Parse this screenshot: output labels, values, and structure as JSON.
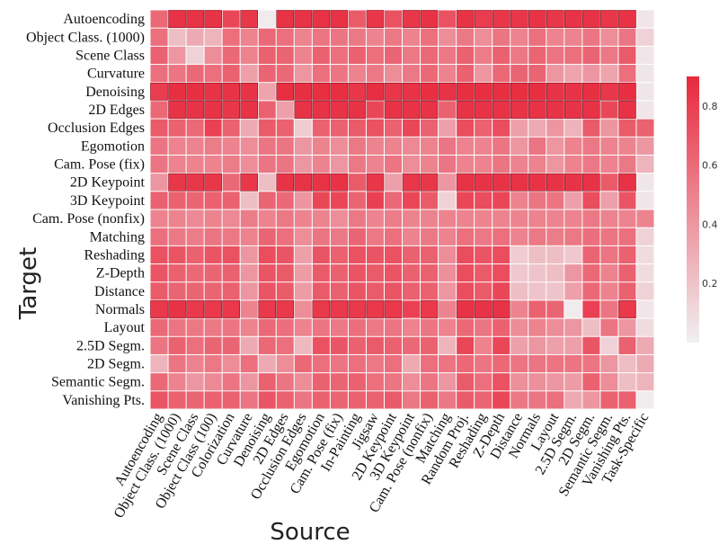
{
  "chart_data": {
    "type": "heatmap",
    "title": "",
    "xlabel": "Source",
    "ylabel": "Target",
    "x_categories": [
      "Autoencoding",
      "Object Class. (1000)",
      "Scene Class",
      "Object Class (100)",
      "Colorization",
      "Curvature",
      "Denoising",
      "2D Edges",
      "Occlusion Edges",
      "Egomotion",
      "Cam. Pose (fix)",
      "In-Painting",
      "Jigsaw",
      "2D Keypoint",
      "3D Keypoint",
      "Cam. Pose (nonfix)",
      "Matching",
      "Random Proj.",
      "Reshading",
      "Z-Depth",
      "Distance",
      "Normals",
      "Layout",
      "2.5D Segm.",
      "2D Segm.",
      "Semantic Segm.",
      "Vanishing Pts.",
      "Task-Specific"
    ],
    "y_categories": [
      "Autoencoding",
      "Object Class. (1000)",
      "Scene Class",
      "Curvature",
      "Denoising",
      "2D Edges",
      "Occlusion Edges",
      "Egomotion",
      "Cam. Pose (fix)",
      "2D Keypoint",
      "3D Keypoint",
      "Cam. Pose (nonfix)",
      "Matching",
      "Reshading",
      "Z-Depth",
      "Distance",
      "Normals",
      "Layout",
      "2.5D Segm.",
      "2D Segm.",
      "Semantic Segm.",
      "Vanishing Pts."
    ],
    "values": [
      [
        0.68,
        0.95,
        0.95,
        0.95,
        0.85,
        0.93,
        0.02,
        0.95,
        0.95,
        0.95,
        0.95,
        0.75,
        0.93,
        0.8,
        0.93,
        0.95,
        0.8,
        0.95,
        0.9,
        0.93,
        0.93,
        0.95,
        0.93,
        0.95,
        0.95,
        0.93,
        0.95,
        0.05
      ],
      [
        0.65,
        0.25,
        0.35,
        0.3,
        0.65,
        0.55,
        0.68,
        0.65,
        0.55,
        0.62,
        0.62,
        0.6,
        0.55,
        0.6,
        0.55,
        0.65,
        0.5,
        0.6,
        0.5,
        0.62,
        0.55,
        0.65,
        0.55,
        0.55,
        0.62,
        0.5,
        0.62,
        0.15
      ],
      [
        0.72,
        0.45,
        0.15,
        0.5,
        0.68,
        0.55,
        0.72,
        0.7,
        0.55,
        0.72,
        0.65,
        0.72,
        0.65,
        0.7,
        0.6,
        0.68,
        0.6,
        0.72,
        0.58,
        0.72,
        0.6,
        0.7,
        0.62,
        0.65,
        0.7,
        0.6,
        0.75,
        0.05
      ],
      [
        0.65,
        0.62,
        0.68,
        0.65,
        0.72,
        0.4,
        0.7,
        0.68,
        0.45,
        0.65,
        0.62,
        0.55,
        0.6,
        0.5,
        0.6,
        0.68,
        0.55,
        0.72,
        0.45,
        0.68,
        0.7,
        0.7,
        0.45,
        0.38,
        0.45,
        0.38,
        0.65,
        0.05
      ],
      [
        0.9,
        0.97,
        0.97,
        0.95,
        0.95,
        0.95,
        0.38,
        0.97,
        0.97,
        0.97,
        0.97,
        0.93,
        0.97,
        0.93,
        0.95,
        0.97,
        0.95,
        0.97,
        0.97,
        0.97,
        0.97,
        0.97,
        0.95,
        0.95,
        0.97,
        0.93,
        0.97,
        0.05
      ],
      [
        0.68,
        0.95,
        0.95,
        0.95,
        0.93,
        0.95,
        0.72,
        0.4,
        0.95,
        0.95,
        0.95,
        0.95,
        0.85,
        0.95,
        0.95,
        0.95,
        0.72,
        0.95,
        0.95,
        0.95,
        0.95,
        0.95,
        0.95,
        0.95,
        0.95,
        0.85,
        0.95,
        0.05
      ],
      [
        0.75,
        0.72,
        0.68,
        0.88,
        0.72,
        0.35,
        0.75,
        0.72,
        0.18,
        0.72,
        0.72,
        0.75,
        0.8,
        0.72,
        0.85,
        0.72,
        0.4,
        0.82,
        0.72,
        0.82,
        0.4,
        0.35,
        0.45,
        0.3,
        0.75,
        0.45,
        0.75,
        0.72
      ],
      [
        0.62,
        0.55,
        0.55,
        0.58,
        0.55,
        0.5,
        0.62,
        0.62,
        0.45,
        0.55,
        0.5,
        0.6,
        0.55,
        0.55,
        0.52,
        0.55,
        0.62,
        0.55,
        0.55,
        0.62,
        0.45,
        0.62,
        0.45,
        0.55,
        0.6,
        0.55,
        0.55,
        0.45
      ],
      [
        0.62,
        0.55,
        0.55,
        0.55,
        0.58,
        0.5,
        0.62,
        0.62,
        0.45,
        0.55,
        0.45,
        0.6,
        0.55,
        0.62,
        0.5,
        0.55,
        0.62,
        0.55,
        0.55,
        0.62,
        0.55,
        0.55,
        0.45,
        0.55,
        0.6,
        0.55,
        0.6,
        0.3
      ],
      [
        0.45,
        0.93,
        0.93,
        0.93,
        0.68,
        0.93,
        0.25,
        0.95,
        0.95,
        0.95,
        0.95,
        0.75,
        0.93,
        0.4,
        0.93,
        0.93,
        0.45,
        0.95,
        0.95,
        0.95,
        0.95,
        0.95,
        0.95,
        0.95,
        0.95,
        0.75,
        0.95,
        0.05
      ],
      [
        0.72,
        0.72,
        0.7,
        0.72,
        0.72,
        0.25,
        0.7,
        0.68,
        0.45,
        0.85,
        0.85,
        0.7,
        0.88,
        0.68,
        0.85,
        0.75,
        0.15,
        0.85,
        0.82,
        0.85,
        0.55,
        0.62,
        0.62,
        0.4,
        0.82,
        0.4,
        0.78,
        0.05
      ],
      [
        0.55,
        0.55,
        0.52,
        0.55,
        0.52,
        0.58,
        0.55,
        0.6,
        0.55,
        0.55,
        0.5,
        0.6,
        0.55,
        0.58,
        0.55,
        0.55,
        0.55,
        0.55,
        0.55,
        0.55,
        0.55,
        0.55,
        0.55,
        0.55,
        0.6,
        0.55,
        0.55,
        0.55
      ],
      [
        0.65,
        0.6,
        0.58,
        0.62,
        0.6,
        0.55,
        0.7,
        0.65,
        0.5,
        0.62,
        0.6,
        0.7,
        0.6,
        0.65,
        0.55,
        0.6,
        0.55,
        0.65,
        0.6,
        0.65,
        0.55,
        0.6,
        0.58,
        0.6,
        0.65,
        0.62,
        0.65,
        0.15
      ],
      [
        0.8,
        0.78,
        0.72,
        0.78,
        0.8,
        0.45,
        0.82,
        0.78,
        0.4,
        0.78,
        0.72,
        0.8,
        0.78,
        0.8,
        0.72,
        0.72,
        0.5,
        0.82,
        0.78,
        0.82,
        0.18,
        0.25,
        0.25,
        0.2,
        0.7,
        0.62,
        0.72,
        0.1
      ],
      [
        0.78,
        0.72,
        0.68,
        0.7,
        0.72,
        0.45,
        0.78,
        0.75,
        0.42,
        0.75,
        0.72,
        0.78,
        0.75,
        0.78,
        0.72,
        0.72,
        0.48,
        0.82,
        0.75,
        0.82,
        0.2,
        0.22,
        0.25,
        0.45,
        0.68,
        0.55,
        0.72,
        0.1
      ],
      [
        0.75,
        0.7,
        0.7,
        0.7,
        0.72,
        0.45,
        0.78,
        0.75,
        0.42,
        0.75,
        0.72,
        0.78,
        0.75,
        0.78,
        0.72,
        0.72,
        0.45,
        0.82,
        0.75,
        0.85,
        0.25,
        0.22,
        0.22,
        0.4,
        0.68,
        0.55,
        0.72,
        0.15
      ],
      [
        0.92,
        0.95,
        0.92,
        0.92,
        0.92,
        0.55,
        0.92,
        0.92,
        0.5,
        0.92,
        0.92,
        0.92,
        0.92,
        0.92,
        0.88,
        0.92,
        0.55,
        0.95,
        0.95,
        0.95,
        0.55,
        0.72,
        0.7,
        0.02,
        0.88,
        0.62,
        0.92,
        0.05
      ],
      [
        0.68,
        0.62,
        0.6,
        0.6,
        0.62,
        0.55,
        0.68,
        0.65,
        0.55,
        0.62,
        0.6,
        0.65,
        0.6,
        0.62,
        0.55,
        0.62,
        0.55,
        0.68,
        0.62,
        0.72,
        0.5,
        0.55,
        0.5,
        0.45,
        0.25,
        0.62,
        0.45,
        0.1
      ],
      [
        0.62,
        0.72,
        0.65,
        0.7,
        0.7,
        0.35,
        0.68,
        0.65,
        0.28,
        0.8,
        0.78,
        0.72,
        0.75,
        0.72,
        0.68,
        0.72,
        0.3,
        0.85,
        0.55,
        0.85,
        0.4,
        0.45,
        0.4,
        0.4,
        0.78,
        0.15,
        0.72,
        0.35
      ],
      [
        0.3,
        0.62,
        0.55,
        0.6,
        0.5,
        0.65,
        0.35,
        0.5,
        0.68,
        0.65,
        0.62,
        0.65,
        0.6,
        0.65,
        0.35,
        0.65,
        0.62,
        0.68,
        0.62,
        0.68,
        0.62,
        0.62,
        0.62,
        0.62,
        0.62,
        0.45,
        0.25,
        0.35
      ],
      [
        0.68,
        0.55,
        0.45,
        0.52,
        0.62,
        0.45,
        0.72,
        0.62,
        0.5,
        0.72,
        0.7,
        0.72,
        0.65,
        0.62,
        0.5,
        0.62,
        0.45,
        0.75,
        0.65,
        0.8,
        0.48,
        0.48,
        0.45,
        0.42,
        0.72,
        0.5,
        0.25,
        0.3
      ],
      [
        0.78,
        0.72,
        0.7,
        0.72,
        0.72,
        0.62,
        0.78,
        0.72,
        0.62,
        0.72,
        0.7,
        0.72,
        0.72,
        0.75,
        0.6,
        0.72,
        0.6,
        0.75,
        0.7,
        0.85,
        0.6,
        0.62,
        0.65,
        0.35,
        0.45,
        0.72,
        0.72,
        0.02
      ]
    ],
    "colorscale": {
      "low": "#f0f0f2",
      "high": "#e8293d"
    },
    "zlim": [
      0,
      1
    ],
    "colorbar": {
      "ticks": [
        0.2,
        0.4,
        0.6,
        0.8
      ],
      "tick_labels": [
        "0.2",
        "0.4",
        "0.6",
        "0.8"
      ],
      "placement": "right"
    },
    "grid": false,
    "legend": "none"
  }
}
